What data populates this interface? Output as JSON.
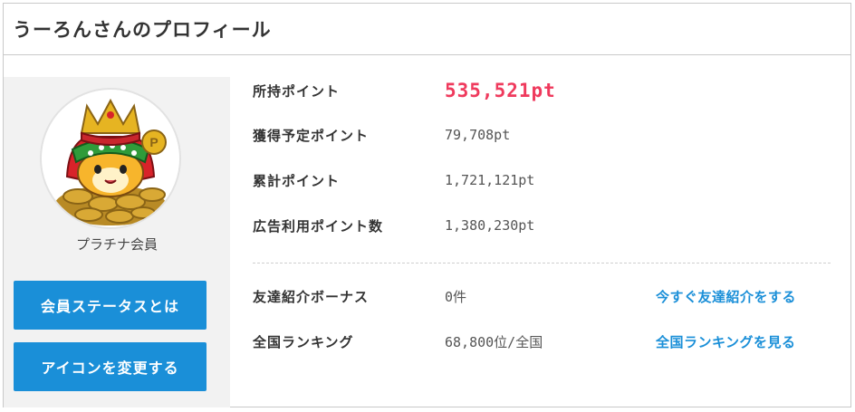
{
  "header": {
    "title": "うーろんさんのプロフィール"
  },
  "profile": {
    "rank": "プラチナ会員",
    "status_button": "会員ステータスとは",
    "icon_button": "アイコンを変更する"
  },
  "points": [
    {
      "label": "所持ポイント",
      "value": "535,521pt"
    },
    {
      "label": "獲得予定ポイント",
      "value": "79,708pt"
    },
    {
      "label": "累計ポイント",
      "value": "1,721,121pt"
    },
    {
      "label": "広告利用ポイント数",
      "value": "1,380,230pt"
    }
  ],
  "extras": [
    {
      "label": "友達紹介ボーナス",
      "value": "0件",
      "link": "今すぐ友達紹介をする"
    },
    {
      "label": "全国ランキング",
      "value": "68,800位/全国",
      "link": "全国ランキングを見る"
    }
  ],
  "colors": {
    "accent": "#1a8fd8",
    "points_highlight": "#ef3a5d",
    "sidebar_bg": "#f2f2f2"
  }
}
